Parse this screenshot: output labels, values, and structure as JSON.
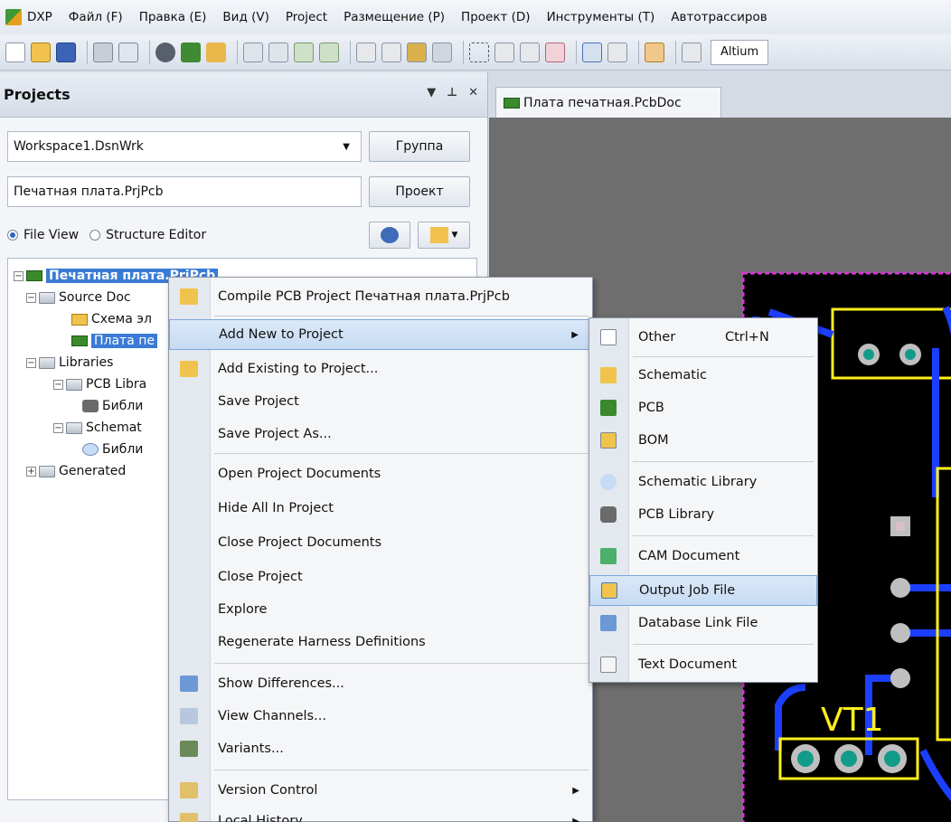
{
  "menubar": {
    "items": [
      "DXP",
      "Файл (F)",
      "Правка (E)",
      "Вид (V)",
      "Project",
      "Размещение (P)",
      "Проект (D)",
      "Инструменты (T)",
      "Автотрассиров"
    ]
  },
  "toolbar": {
    "combo_value": "Altium"
  },
  "panel": {
    "title": "Projects",
    "workspace_value": "Workspace1.DsnWrk",
    "group_button": "Группа",
    "project_value": "Печатная плата.PrjPcb",
    "project_button": "Проект",
    "view_file": "File View",
    "view_structure": "Structure Editor"
  },
  "tree": {
    "root": "Печатная плата.PrjPcb",
    "source_docs": "Source Doc",
    "schematic_doc": "Схема эл",
    "pcb_doc": "Плата пе",
    "libraries": "Libraries",
    "pcb_libs": "PCB Libra",
    "pcb_lib_item": "Библи",
    "sch_libs": "Schemat",
    "sch_lib_item": "Библи",
    "generated": "Generated"
  },
  "document_tab": {
    "label": "Плата печатная.PcbDoc"
  },
  "context_menu": {
    "compile": "Compile PCB Project Печатная плата.PrjPcb",
    "add_new": "Add New to Project",
    "add_existing": "Add Existing to Project...",
    "save_project": "Save Project",
    "save_project_as": "Save Project As...",
    "open_docs": "Open Project Documents",
    "hide_all": "Hide All In Project",
    "close_docs": "Close Project Documents",
    "close_project": "Close Project",
    "explore": "Explore",
    "regenerate": "Regenerate Harness Definitions",
    "show_diff": "Show Differences...",
    "view_channels": "View Channels...",
    "variants": "Variants...",
    "version_control": "Version Control",
    "local_history": "Local History"
  },
  "submenu": {
    "other": "Other",
    "other_shortcut": "Ctrl+N",
    "schematic": "Schematic",
    "pcb": "PCB",
    "bom": "BOM",
    "schematic_library": "Schematic Library",
    "pcb_library": "PCB Library",
    "cam_document": "CAM Document",
    "output_job": "Output Job File",
    "database_link": "Database Link File",
    "text_document": "Text Document"
  },
  "pcb_canvas": {
    "designator": "VT1"
  }
}
